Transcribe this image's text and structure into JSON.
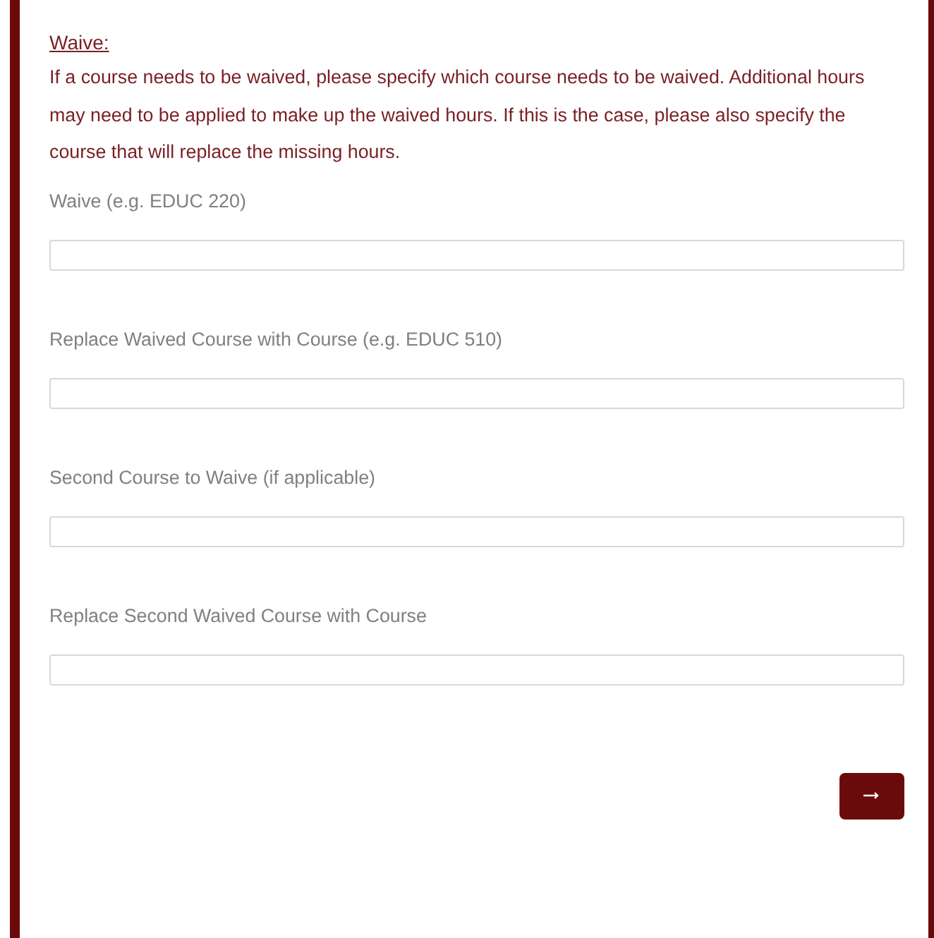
{
  "section": {
    "heading": "Waive:",
    "description": "If a course needs to be waived, please specify which course needs to be waived. Additional hours may need to be applied to make up the waived hours. If this is the case, please also specify the course that will replace the missing hours."
  },
  "fields": [
    {
      "label": "Waive (e.g. EDUC 220)"
    },
    {
      "label": "Replace Waived Course with Course (e.g. EDUC 510)"
    },
    {
      "label": "Second Course to Waive (if applicable)"
    },
    {
      "label": "Replace Second Waived Course with Course"
    }
  ]
}
